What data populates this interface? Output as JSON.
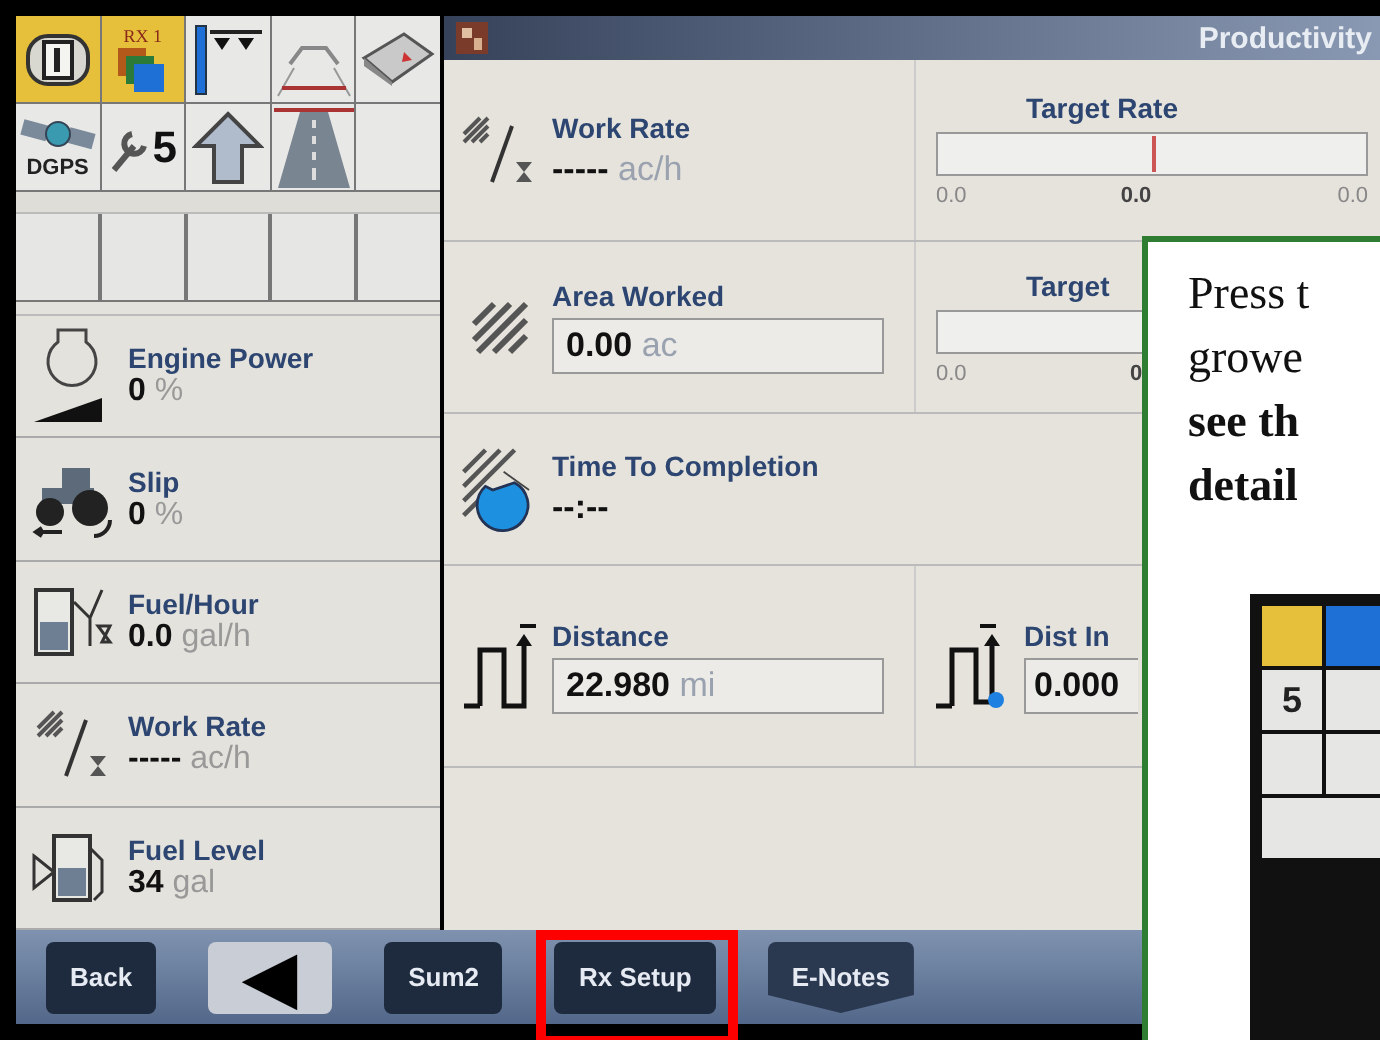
{
  "status_tiles": [
    {
      "kind": "gear-one",
      "active": true
    },
    {
      "kind": "rx",
      "label": "RX 1",
      "active": true
    },
    {
      "kind": "implement",
      "active": false
    },
    {
      "kind": "outline",
      "active": false
    },
    {
      "kind": "book",
      "active": false
    },
    {
      "kind": "gps",
      "label": "DGPS",
      "active": false
    },
    {
      "kind": "wrench",
      "label": "5",
      "active": false
    },
    {
      "kind": "arrow",
      "active": false
    },
    {
      "kind": "road",
      "active": false
    },
    {
      "kind": "empty",
      "active": false
    }
  ],
  "readouts": [
    {
      "kind": "engine",
      "label": "Engine Power",
      "value": "0",
      "unit": "%"
    },
    {
      "kind": "slip",
      "label": "Slip",
      "value": "0",
      "unit": "%"
    },
    {
      "kind": "fuel-rate",
      "label": "Fuel/Hour",
      "value": "0.0",
      "unit": "gal/h"
    },
    {
      "kind": "work-rate",
      "label": "Work Rate",
      "value": "-----",
      "unit": "ac/h"
    },
    {
      "kind": "fuel-level",
      "label": "Fuel Level",
      "value": "34",
      "unit": "gal"
    }
  ],
  "productivity": {
    "title": "Productivity",
    "rows": [
      [
        {
          "kind": "readout",
          "label": "Work Rate",
          "value": "-----",
          "unit": "ac/h"
        },
        {
          "kind": "gauge",
          "label": "Target Rate",
          "ticks": [
            "0.0",
            "0.0",
            "0.0"
          ]
        }
      ],
      [
        {
          "kind": "field",
          "label": "Area Worked",
          "value": "0.00",
          "unit": "ac"
        },
        {
          "kind": "gauge",
          "label": "Target",
          "ticks": [
            "0.0",
            "0"
          ]
        }
      ],
      [
        {
          "kind": "readout",
          "label": "Time To Completion",
          "value": "--:--"
        }
      ],
      [
        {
          "kind": "field",
          "label": "Distance",
          "value": "22.980",
          "unit": "mi"
        },
        {
          "kind": "field",
          "label": "Dist In",
          "value": "0.000"
        }
      ]
    ]
  },
  "softkeys": [
    {
      "kind": "dark",
      "label": "Back",
      "highlighted": false
    },
    {
      "kind": "light",
      "label": "◀",
      "highlighted": false
    },
    {
      "kind": "dark",
      "label": "Sum2",
      "highlighted": false
    },
    {
      "kind": "dark",
      "label": "Rx Setup",
      "highlighted": true
    },
    {
      "kind": "tab",
      "label": "E-Notes",
      "highlighted": false
    }
  ],
  "callout": {
    "lines": [
      {
        "text": "Press t",
        "bold": false
      },
      {
        "text": "growe",
        "bold": false
      },
      {
        "text": "see th",
        "bold": true
      },
      {
        "text": "detail",
        "bold": true
      }
    ],
    "preview": {
      "count": "5"
    }
  }
}
